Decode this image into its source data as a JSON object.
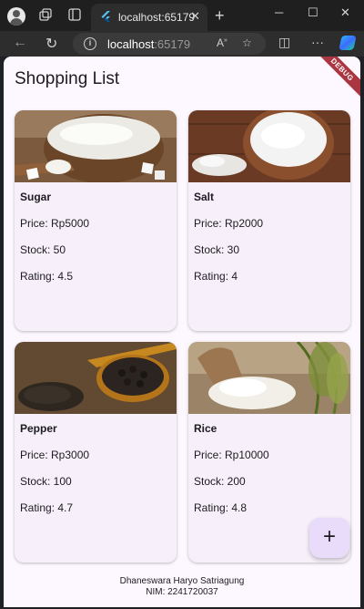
{
  "browser": {
    "tab_title": "localhost:65179",
    "tab_close": "✕",
    "new_tab": "+",
    "url_host": "localhost",
    "url_port": ":65179",
    "icons": [
      "profile-icon",
      "workspaces-icon",
      "tab-actions-icon",
      "back-icon",
      "refresh-icon",
      "info-icon",
      "read-aloud-icon",
      "favorite-icon",
      "split-screen-icon",
      "more-icon",
      "copilot-icon",
      "minimize-icon",
      "maximize-icon",
      "close-icon"
    ]
  },
  "app": {
    "title": "Shopping List",
    "debug_banner": "DEBUG",
    "fab_label": "+",
    "footer": {
      "name": "Dhaneswara Haryo Satriagung",
      "nim": "NIM: 2241720037"
    }
  },
  "products": [
    {
      "name": "Sugar",
      "price": "Price: Rp5000",
      "stock": "Stock: 50",
      "rating": "Rating: 4.5",
      "image": "sugar-bowl"
    },
    {
      "name": "Salt",
      "price": "Price: Rp2000",
      "stock": "Stock: 30",
      "rating": "Rating: 4",
      "image": "salt-bowl"
    },
    {
      "name": "Pepper",
      "price": "Price: Rp3000",
      "stock": "Stock: 100",
      "rating": "Rating: 4.7",
      "image": "peppercorn-spoon"
    },
    {
      "name": "Rice",
      "price": "Price: Rp10000",
      "stock": "Stock: 200",
      "rating": "Rating: 4.8",
      "image": "rice-sack"
    }
  ],
  "colors": {
    "background": "#fdf7ff",
    "card": "#f7f0fa",
    "fab": "#e8dcfa",
    "debug": "#a93640"
  }
}
